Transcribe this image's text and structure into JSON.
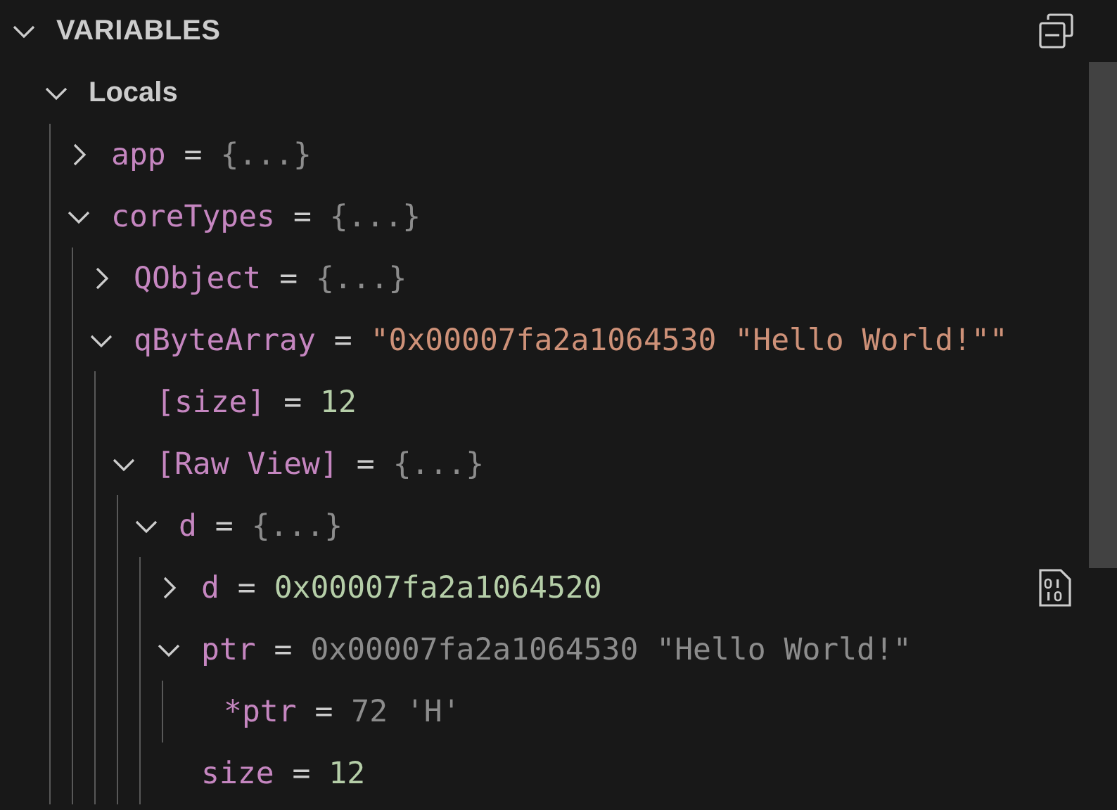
{
  "panel": {
    "title": "VARIABLES",
    "expanded": true
  },
  "scopes": [
    {
      "name": "Locals",
      "expanded": true,
      "children": [
        {
          "name": "app",
          "operator": "=",
          "value": "{...}",
          "kind": "object",
          "expanded": false,
          "hovered": false
        },
        {
          "name": "coreTypes",
          "operator": "=",
          "value": "{...}",
          "kind": "object",
          "expanded": true,
          "hovered": false,
          "children": [
            {
              "name": "QObject",
              "operator": "=",
              "value": "{...}",
              "kind": "object",
              "expanded": false,
              "hovered": false
            },
            {
              "name": "qByteArray",
              "operator": "=",
              "value": "\"0x00007fa2a1064530 \"Hello World!\"\"",
              "kind": "string",
              "expanded": true,
              "hovered": false,
              "children": [
                {
                  "name": "[size]",
                  "operator": "=",
                  "value": "12",
                  "kind": "number",
                  "hovered": false
                },
                {
                  "name": "[Raw View]",
                  "operator": "=",
                  "value": "{...}",
                  "kind": "object",
                  "expanded": true,
                  "hovered": false,
                  "children": [
                    {
                      "name": "d",
                      "operator": "=",
                      "value": "{...}",
                      "kind": "object",
                      "expanded": true,
                      "hovered": false,
                      "children": [
                        {
                          "name": "d",
                          "operator": "=",
                          "value": "0x00007fa2a1064520",
                          "kind": "number",
                          "expanded": false,
                          "hovered": true
                        },
                        {
                          "name": "ptr",
                          "operator": "=",
                          "value": "0x00007fa2a1064530 \"Hello World!\"",
                          "kind": "other",
                          "expanded": true,
                          "hovered": false,
                          "children": [
                            {
                              "name": "*ptr",
                              "operator": "=",
                              "value": "72 'H'",
                              "kind": "other",
                              "hovered": false
                            }
                          ]
                        },
                        {
                          "name": "size",
                          "operator": "=",
                          "value": "12",
                          "kind": "number",
                          "hovered": false
                        }
                      ]
                    }
                  ]
                }
              ]
            }
          ]
        }
      ]
    }
  ]
}
